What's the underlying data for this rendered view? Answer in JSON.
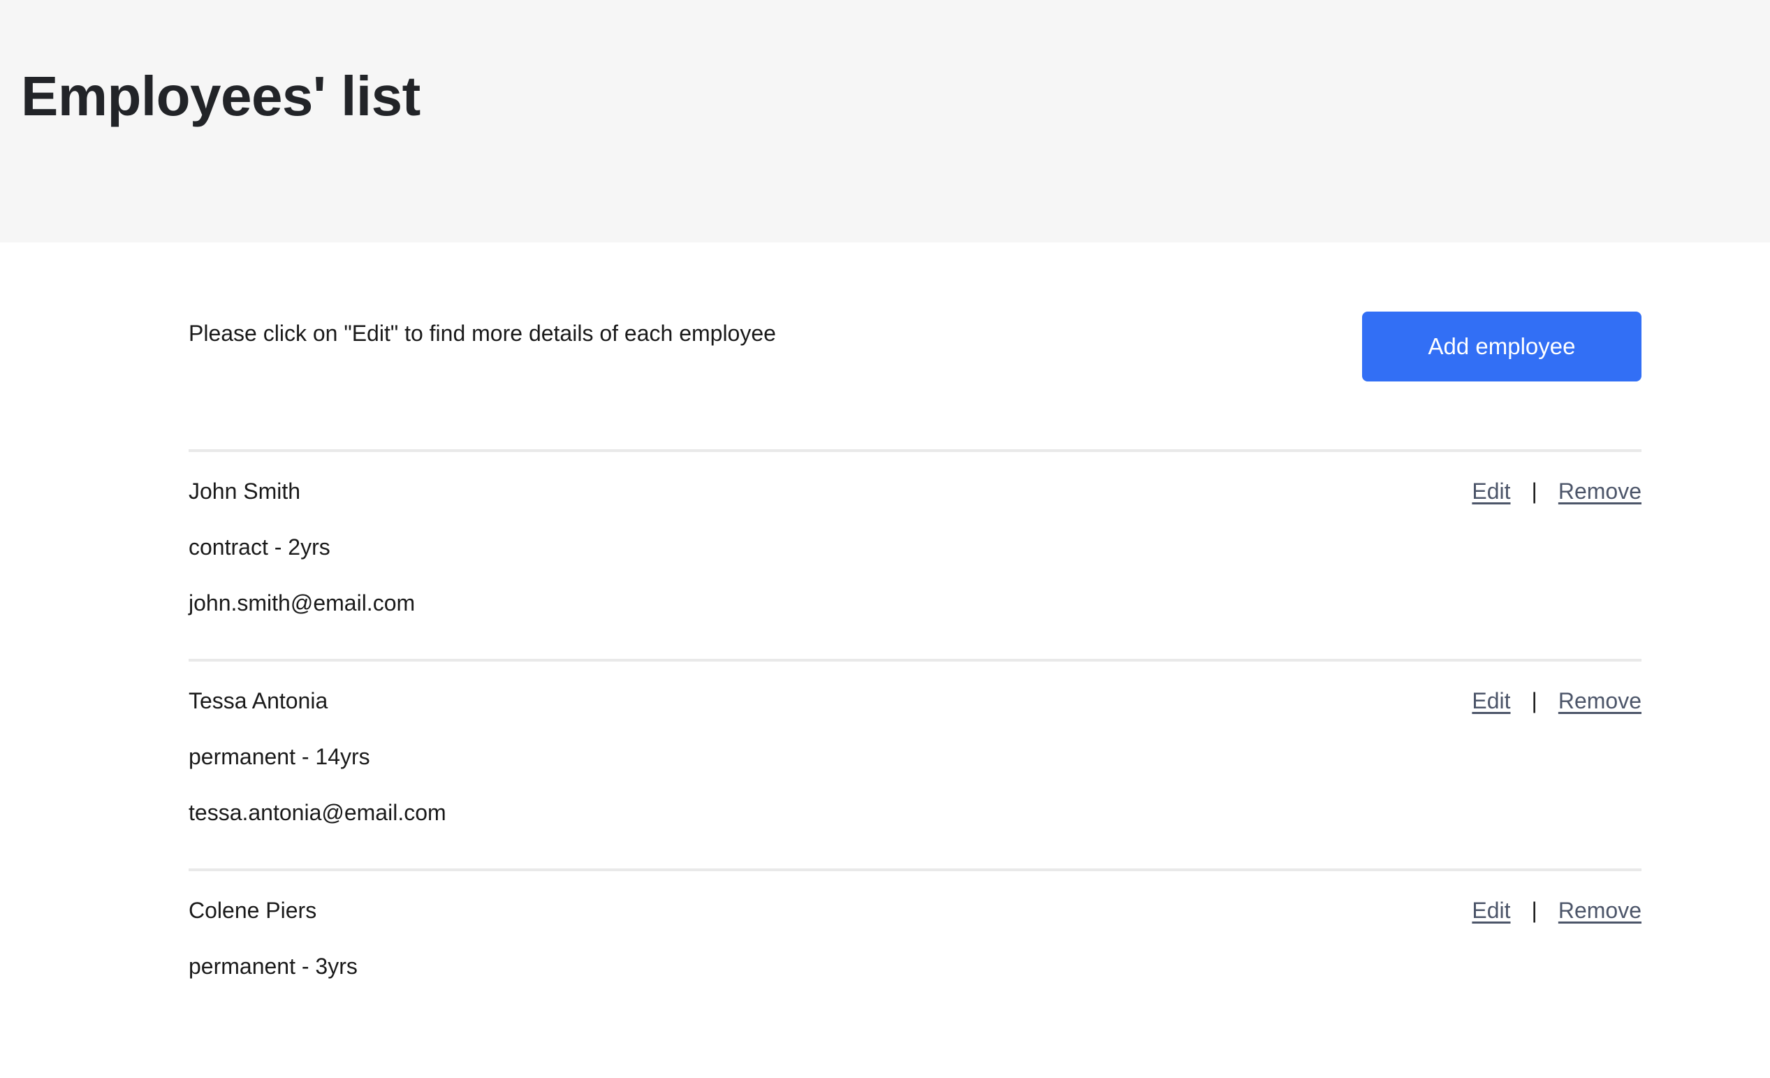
{
  "header": {
    "title": "Employees' list"
  },
  "main": {
    "intro": "Please click on \"Edit\" to find more details of each employee",
    "add_button_label": "Add employee",
    "actions": {
      "edit_label": "Edit",
      "separator": "|",
      "remove_label": "Remove"
    },
    "employees": [
      {
        "name": "John Smith",
        "type": "contract - 2yrs",
        "email": "john.smith@email.com"
      },
      {
        "name": "Tessa Antonia",
        "type": "permanent - 14yrs",
        "email": "tessa.antonia@email.com"
      },
      {
        "name": "Colene Piers",
        "type": "permanent - 3yrs",
        "email": ""
      }
    ]
  },
  "colors": {
    "accent": "#326ff5",
    "header_bg": "#f6f6f6",
    "link": "#4c5569",
    "divider": "#e9e9e9"
  }
}
